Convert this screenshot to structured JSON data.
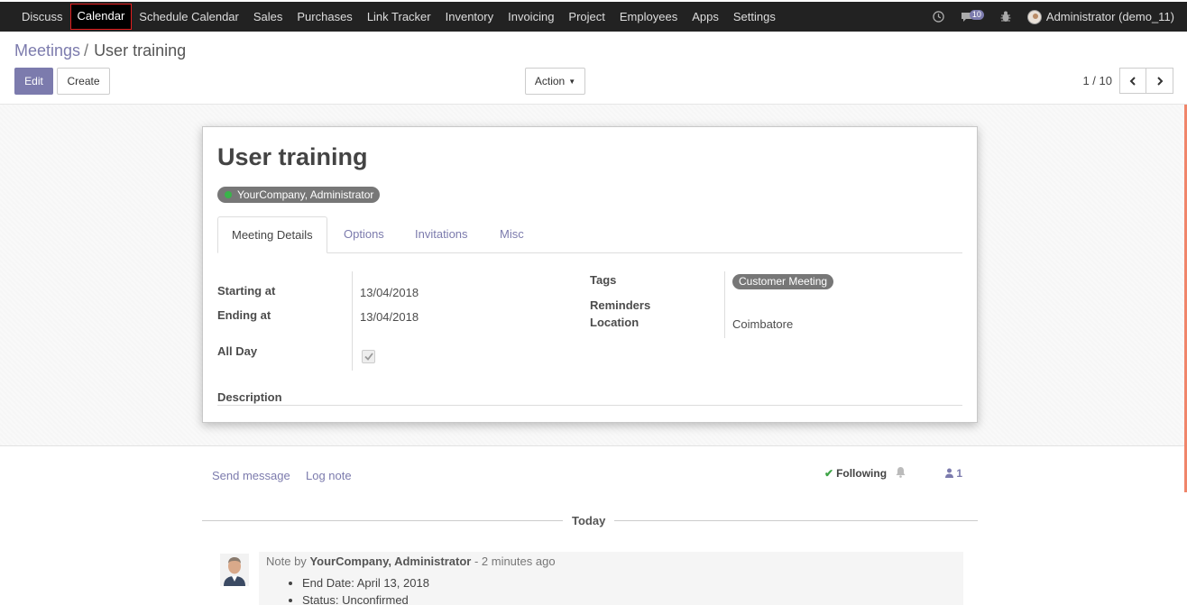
{
  "topbar": {
    "menu": [
      "Discuss",
      "Calendar",
      "Schedule Calendar",
      "Sales",
      "Purchases",
      "Link Tracker",
      "Inventory",
      "Invoicing",
      "Project",
      "Employees",
      "Apps",
      "Settings"
    ],
    "active_index": 1,
    "message_count": "10",
    "user": "Administrator (demo_11)"
  },
  "breadcrumb": {
    "parent": "Meetings",
    "separator": "/",
    "current": "User training"
  },
  "buttons": {
    "edit": "Edit",
    "create": "Create",
    "action": "Action"
  },
  "pager": {
    "value": "1 / 10"
  },
  "record": {
    "title": "User training",
    "attendee": "YourCompany, Administrator",
    "tabs": [
      "Meeting Details",
      "Options",
      "Invitations",
      "Misc"
    ],
    "fields": {
      "starting_at_label": "Starting at",
      "starting_at": "13/04/2018",
      "ending_at_label": "Ending at",
      "ending_at": "13/04/2018",
      "all_day_label": "All Day",
      "all_day": true,
      "tags_label": "Tags",
      "tags": [
        "Customer Meeting"
      ],
      "reminders_label": "Reminders",
      "location_label": "Location",
      "location": "Coimbatore",
      "description_label": "Description"
    }
  },
  "chatter": {
    "send_message": "Send message",
    "log_note": "Log note",
    "following": "Following",
    "followers_count": "1",
    "today": "Today",
    "message": {
      "prefix": "Note by",
      "author": "YourCompany, Administrator",
      "time": "- 2 minutes ago",
      "items": [
        "End Date: April 13, 2018",
        "Status: Unconfirmed"
      ]
    }
  },
  "colors": {
    "primary": "#7c7bad",
    "topbar": "#222222",
    "active_outline": "#e41e1e"
  }
}
